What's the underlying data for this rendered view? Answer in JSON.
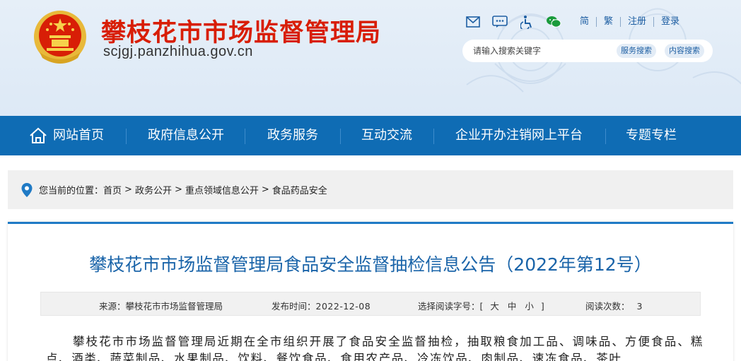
{
  "header": {
    "site_title": "攀枝花市市场监督管理局",
    "site_domain": "scjgj.panzhihua.gov.cn",
    "icons": [
      "mail-icon",
      "message-icon",
      "accessibility-icon",
      "wechat-icon"
    ],
    "lang_links": [
      "简",
      "繁"
    ],
    "account_links": [
      "注册",
      "登录"
    ],
    "search": {
      "placeholder": "请输入搜索关键字",
      "service_button": "服务搜索",
      "content_button": "内容搜索"
    }
  },
  "nav": {
    "items": [
      {
        "label": "网站首页",
        "icon": "home-icon"
      },
      {
        "label": "政府信息公开"
      },
      {
        "label": "政务服务"
      },
      {
        "label": "互动交流"
      },
      {
        "label": "企业开办注销网上平台"
      },
      {
        "label": "专题专栏"
      }
    ]
  },
  "breadcrumb": {
    "prefix": "您当前的位置：",
    "items": [
      "首页",
      "政务公开",
      "重点领域信息公开",
      "食品药品安全"
    ],
    "separator": ">"
  },
  "article": {
    "title": "攀枝花市市场监督管理局食品安全监督抽检信息公告（2022年第12号）",
    "source_label": "来源：",
    "source": "攀枝花市市场监督管理局",
    "date_label": "发布时间：",
    "date": "2022-12-08",
    "font_label": "选择阅读字号：[",
    "font_sizes": [
      "大",
      "中",
      "小"
    ],
    "font_close": "]",
    "views_label": "阅读次数：",
    "views": "3",
    "body": "攀枝花市市场监督管理局近期在全市组织开展了食品安全监督抽检，抽取粮食加工品、调味品、方便食品、糕点、酒类、蔬菜制品、水果制品、饮料、餐饮食品、食用农产品、冷冻饮品、肉制品、速冻食品、茶叶"
  },
  "colors": {
    "brand_red": "#d81e06",
    "nav_blue": "#0f6cb4",
    "title_blue": "#1a64a9",
    "link_blue": "#1e5fa3"
  }
}
